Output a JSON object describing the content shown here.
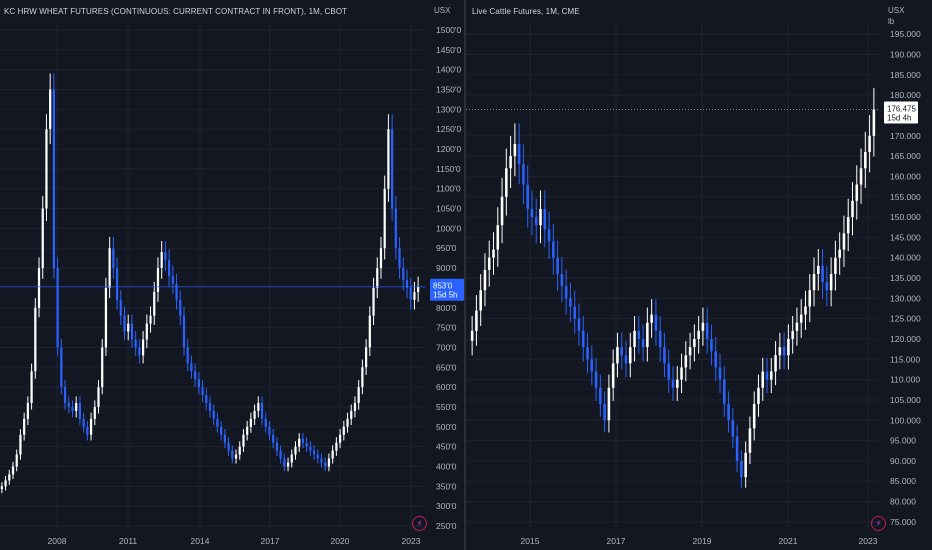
{
  "colors": {
    "background": "#131722",
    "up": "#ffffff",
    "down": "#2962ff",
    "grid": "#1f2330",
    "axis_text": "#b2b5be",
    "price_line": "#2962ff",
    "right_price_line": "#b2b5be"
  },
  "chart_data": [
    {
      "type": "candlestick",
      "title": "KC HRW WHEAT FUTURES (CONTINUOUS: CURRENT CONTRACT IN FRONT), 1M, CBOT",
      "unit_label": "USX",
      "y_ticks": [
        "250'0",
        "300'0",
        "350'0",
        "400'0",
        "450'0",
        "500'0",
        "550'0",
        "600'0",
        "650'0",
        "700'0",
        "750'0",
        "800'0",
        "900'0",
        "950'0",
        "1000'0",
        "1050'0",
        "1100'0",
        "1150'0",
        "1200'0",
        "1250'0",
        "1300'0",
        "1350'0",
        "1400'0",
        "1450'0",
        "1500'0"
      ],
      "ylim": [
        240,
        1520
      ],
      "x_ticks": [
        "2008",
        "2011",
        "2014",
        "2017",
        "2020",
        "2023"
      ],
      "last_price_label": "853'0",
      "countdown_label": "15d 5h",
      "last_price": 853,
      "closes": [
        350,
        365,
        380,
        400,
        430,
        480,
        520,
        560,
        640,
        800,
        900,
        1050,
        1250,
        1350,
        900,
        700,
        600,
        560,
        550,
        540,
        560,
        520,
        500,
        480,
        520,
        550,
        600,
        700,
        850,
        950,
        900,
        820,
        780,
        740,
        760,
        720,
        700,
        680,
        720,
        760,
        780,
        840,
        900,
        940,
        920,
        880,
        860,
        820,
        780,
        700,
        660,
        640,
        620,
        600,
        580,
        560,
        540,
        520,
        500,
        480,
        460,
        440,
        420,
        430,
        450,
        480,
        500,
        520,
        540,
        560,
        520,
        500,
        480,
        460,
        440,
        420,
        400,
        410,
        430,
        450,
        470,
        460,
        450,
        440,
        430,
        420,
        410,
        400,
        420,
        440,
        460,
        480,
        500,
        520,
        540,
        560,
        600,
        650,
        700,
        780,
        850,
        900,
        950,
        1100,
        1250,
        1050,
        950,
        900,
        870,
        850,
        820,
        840,
        853
      ]
    },
    {
      "type": "candlestick",
      "title": "Live Cattle Futures, 1M, CME",
      "unit_label": "USX",
      "unit_sub": "lb",
      "y_ticks": [
        "75.000",
        "80.000",
        "85.000",
        "90.000",
        "95.000",
        "100.000",
        "105.000",
        "110.000",
        "115.000",
        "120.000",
        "125.000",
        "130.000",
        "135.000",
        "140.000",
        "145.000",
        "150.000",
        "155.000",
        "160.000",
        "165.000",
        "170.000",
        "180.000",
        "185.000",
        "190.000",
        "195.000"
      ],
      "ylim": [
        73,
        198
      ],
      "x_ticks": [
        "2015",
        "2017",
        "2019",
        "2021",
        "2023"
      ],
      "last_price_label": "176.475",
      "countdown_label": "15d 4h",
      "last_price": 176.475,
      "closes": [
        122,
        127,
        132,
        137,
        140,
        142,
        148,
        155,
        162,
        165,
        168,
        163,
        158,
        152,
        150,
        148,
        152,
        147,
        144,
        140,
        136,
        133,
        130,
        128,
        125,
        122,
        118,
        115,
        112,
        108,
        104,
        100,
        108,
        114,
        118,
        116,
        114,
        118,
        122,
        120,
        118,
        124,
        126,
        122,
        118,
        114,
        110,
        108,
        110,
        113,
        116,
        118,
        120,
        122,
        124,
        120,
        117,
        113,
        110,
        104,
        100,
        96,
        90,
        86,
        92,
        98,
        104,
        108,
        112,
        110,
        112,
        116,
        118,
        116,
        120,
        122,
        124,
        126,
        128,
        132,
        136,
        138,
        134,
        132,
        136,
        140,
        142,
        146,
        150,
        154,
        158,
        162,
        166,
        170,
        176.475
      ]
    }
  ]
}
